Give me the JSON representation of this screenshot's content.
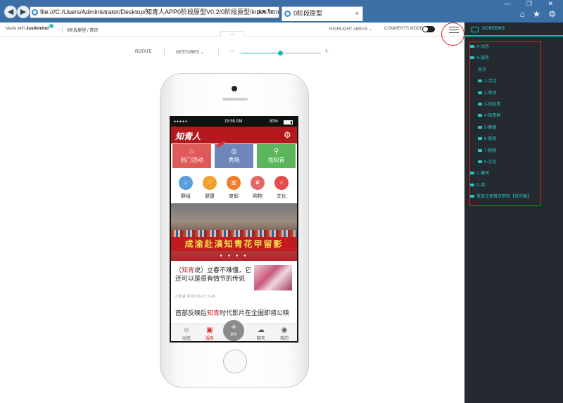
{
  "browser": {
    "address": "file:///C:/Users/Administrator/Desktop/知青人APP0阶段原型V0.2/0阶段原型/index.html#/screens/2",
    "address_tools": "ρ ▾ ↻",
    "tab_title": "0阶段原型",
    "tab_close": "×",
    "window_controls": "— ❐ ✕",
    "favorites_icons": "⌂ ★ ⚙"
  },
  "viewer": {
    "made_with_prefix": "Made with",
    "made_with_brand": "Justinmind",
    "breadcrumb": "0阶段原型 / 首页",
    "highlight_areas": "HIGHLIGHT AREAS",
    "comments_mode": "COMMENTS MODE",
    "rotate": "ROTATE",
    "gestures": "GESTURES",
    "zoom_minus": "−",
    "zoom_plus": "+",
    "zoom_level": 0.49,
    "collapse_icon": "chevron-up-icon"
  },
  "app": {
    "status": {
      "signal": "●●●●●",
      "time": "15:55 AM",
      "battery": "80%"
    },
    "logo": "知青人",
    "settings_icon": "gear-icon",
    "tiles": [
      {
        "label": "热门活动",
        "icon": "flame-icon",
        "color": "#e05a5a"
      },
      {
        "label": "秀场",
        "icon": "medal-icon",
        "color": "#6e87b8"
      },
      {
        "label": "找知青",
        "icon": "person-search-icon",
        "color": "#5bb55b"
      }
    ],
    "categories": [
      {
        "label": "群组",
        "icon": "group-icon",
        "color": "#5a9fd8"
      },
      {
        "label": "健康",
        "icon": "heart-icon",
        "color": "#f0a030"
      },
      {
        "label": "度假",
        "icon": "building-icon",
        "color": "#f07c2c"
      },
      {
        "label": "购物",
        "icon": "trophy-icon",
        "color": "#e26868"
      },
      {
        "label": "文化",
        "icon": "star-icon",
        "color": "#e64b4b"
      }
    ],
    "banner_text": "成渝赴滇知青花甲留影",
    "banner_dots": "● ● ● ●",
    "article1": {
      "prefix": "（",
      "highlight": "知青",
      "rest": "说）立春不难懂，它还可以是很有情节的传说",
      "meta": "小知青  评论0  06-21 11:45"
    },
    "article2": {
      "prefix": "首部反映后",
      "highlight": "知青",
      "rest": "时代影片在全国即将公映"
    },
    "tabbar": [
      {
        "label": "动态",
        "icon": "chat-person-icon"
      },
      {
        "label": "服务",
        "icon": "box-icon"
      },
      {
        "label": "发布",
        "icon": "plus-icon"
      },
      {
        "label": "聊天",
        "icon": "chat-bubbles-icon"
      },
      {
        "label": "我的",
        "icon": "user-icon"
      }
    ]
  },
  "sidebar": {
    "title": "SCREENS",
    "items": [
      {
        "label": "A-动态",
        "level": 0
      },
      {
        "label": "B-服务",
        "level": 0
      },
      {
        "label": "首页",
        "level": 1
      },
      {
        "label": "1-活动",
        "level": 2
      },
      {
        "label": "2-秀场",
        "level": 2
      },
      {
        "label": "3-找知青",
        "level": 2
      },
      {
        "label": "4-知青群",
        "level": 2
      },
      {
        "label": "5-健康",
        "level": 2
      },
      {
        "label": "6-度假",
        "level": 2
      },
      {
        "label": "7-购物",
        "level": 2
      },
      {
        "label": "8-文化",
        "level": 2
      },
      {
        "label": "C-聊天",
        "level": 0
      },
      {
        "label": "D-我",
        "level": 0
      },
      {
        "label": "登录注册首页密码【待完善】",
        "level": 0
      }
    ]
  }
}
